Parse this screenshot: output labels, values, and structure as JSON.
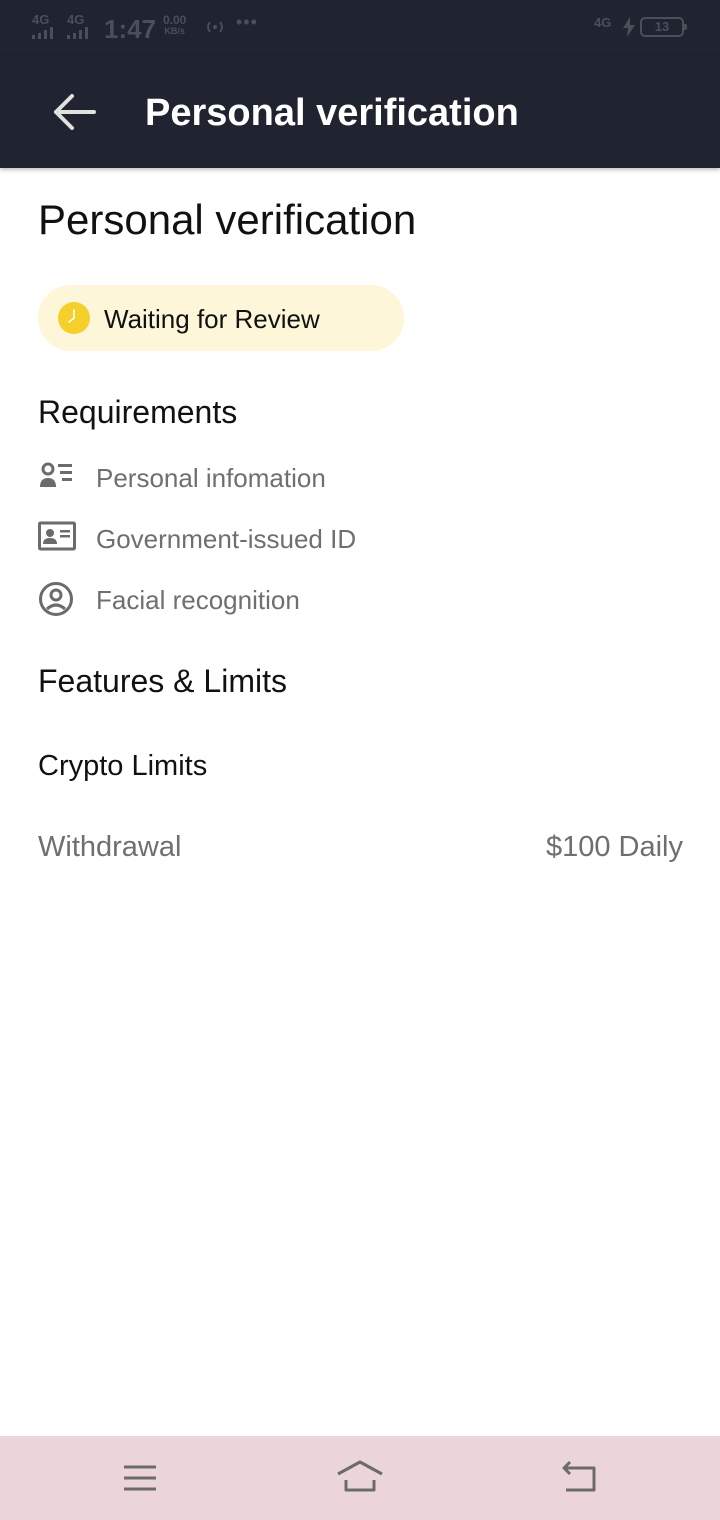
{
  "status_bar": {
    "signal1": "4G",
    "signal2": "4G",
    "time": "1:47",
    "speed_value": "0.00",
    "speed_unit": "KB/s",
    "dots": "•••",
    "network_right": "4G",
    "battery": "13"
  },
  "app_bar": {
    "title": "Personal verification",
    "back_icon": "arrow-left-icon"
  },
  "page": {
    "title": "Personal verification",
    "status": {
      "text": "Waiting for Review",
      "icon": "clock-icon",
      "color": "#f5cf2a"
    },
    "requirements": {
      "heading": "Requirements",
      "items": [
        {
          "label": "Personal infomation",
          "icon": "person-info-icon"
        },
        {
          "label": "Government-issued ID",
          "icon": "id-card-icon"
        },
        {
          "label": "Facial recognition",
          "icon": "face-icon"
        }
      ]
    },
    "features": {
      "heading": "Features & Limits",
      "crypto_heading": "Crypto Limits",
      "limits": [
        {
          "label": "Withdrawal",
          "value": "$100 Daily"
        }
      ]
    }
  },
  "nav_bar": {
    "menu_icon": "menu-icon",
    "home_icon": "home-icon",
    "back_icon": "return-icon"
  },
  "colors": {
    "app_bar": "#1f2430",
    "pill_bg": "#fdf6d8",
    "accent": "#f5cf2a",
    "nav_bar": "#ecd5d9"
  }
}
